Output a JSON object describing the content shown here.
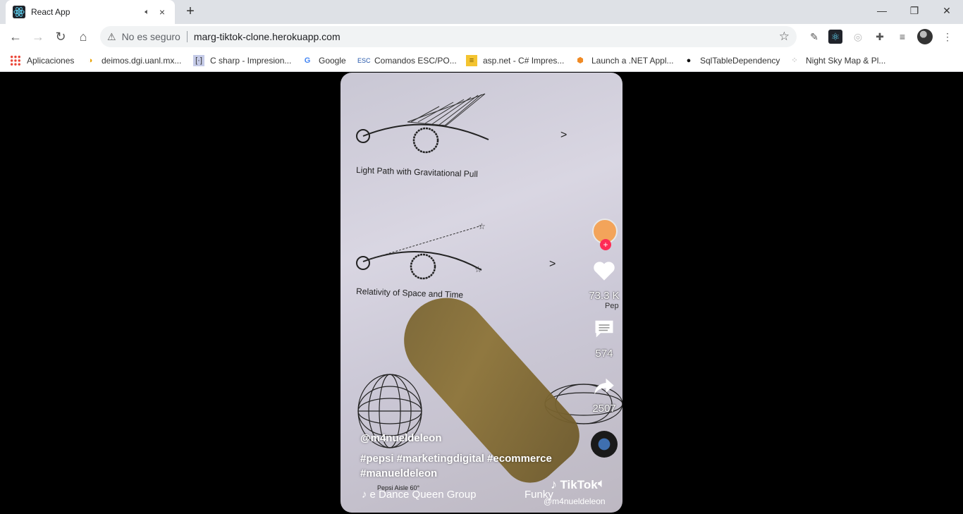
{
  "browser": {
    "tab_title": "React App",
    "tab_audio_icon": "speaker-icon",
    "tab_close": "×",
    "new_tab": "+",
    "security_label": "No es seguro",
    "url": "marg-tiktok-clone.herokuapp.com",
    "window": {
      "minimize": "—",
      "restore": "❐",
      "close": "✕"
    }
  },
  "bookmarks": [
    {
      "label": "Aplicaciones",
      "icon": "apps-grid-icon"
    },
    {
      "label": "deimos.dgi.uanl.mx...",
      "icon": "deimos-icon"
    },
    {
      "label": "C sharp - Impresion...",
      "icon": "page-icon"
    },
    {
      "label": "Google",
      "icon": "google-icon"
    },
    {
      "label": "Comandos ESC/PO...",
      "icon": "esc-icon"
    },
    {
      "label": "asp.net - C# Impres...",
      "icon": "stack-icon"
    },
    {
      "label": "Launch a .NET Appl...",
      "icon": "aws-icon"
    },
    {
      "label": "SqlTableDependency",
      "icon": "github-icon"
    },
    {
      "label": "Night Sky Map & Pl...",
      "icon": "sky-icon"
    }
  ],
  "video": {
    "drawing_labels": {
      "label_1": "Light Path with Gravitational Pull",
      "label_2": "Relativity of Space and Time",
      "label_3": "Pepsi Aisle 60°"
    },
    "author": "@m4nueldeleon",
    "hashtags": "#pepsi #marketingdigital #ecommerce #manueldeleon",
    "song_ticker": "e Dance Queen Group",
    "song_ticker_tail": "Funky",
    "watermark_name": "TikTok",
    "watermark_handle": "@m4nueldeleon",
    "likes": "73.3 K",
    "comments": "574",
    "shares": "2507",
    "follow_plus": "+",
    "side_text": "Pep"
  },
  "colors": {
    "accent": "#fe2c55",
    "chrome_bg": "#dee1e6",
    "page_bg": "#000000"
  }
}
